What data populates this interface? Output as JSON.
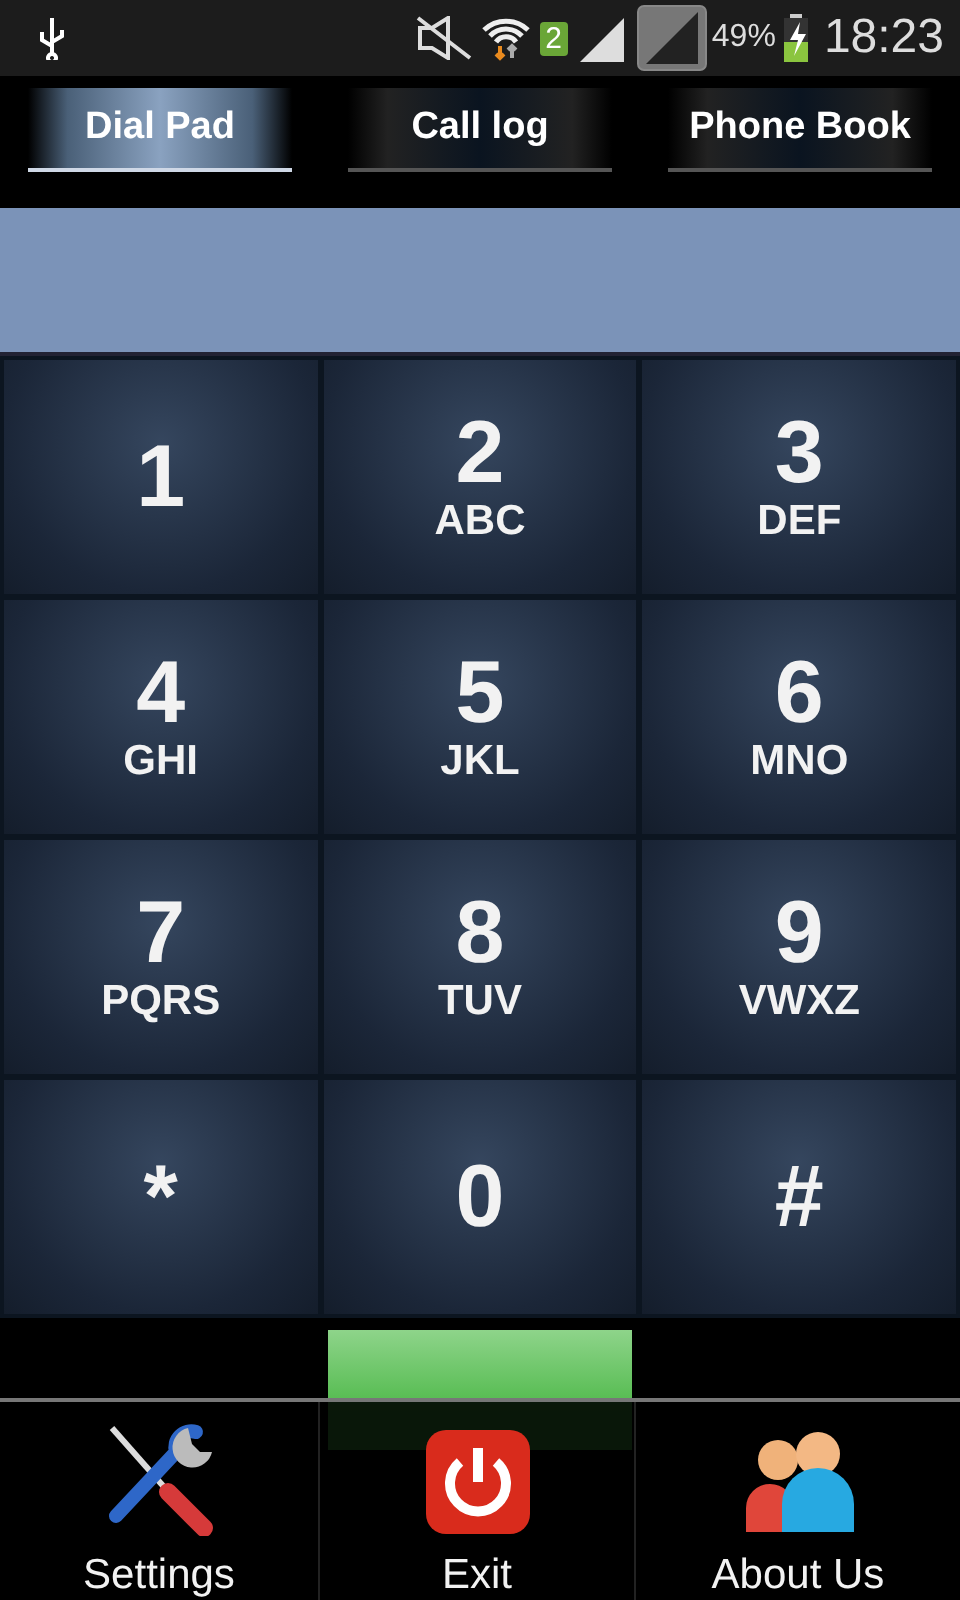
{
  "status_bar": {
    "battery": "49%",
    "time": "18:23",
    "sim_badge": "2"
  },
  "tabs": [
    {
      "label": "Dial Pad",
      "selected": true
    },
    {
      "label": "Call log",
      "selected": false
    },
    {
      "label": "Phone Book",
      "selected": false
    }
  ],
  "keys": [
    {
      "digit": "1"
    },
    {
      "digit": "2",
      "letters": "ABC"
    },
    {
      "digit": "3",
      "letters": "DEF"
    },
    {
      "digit": "4",
      "letters": "GHI"
    },
    {
      "digit": "5",
      "letters": "JKL"
    },
    {
      "digit": "6",
      "letters": "MNO"
    },
    {
      "digit": "7",
      "letters": "PQRS"
    },
    {
      "digit": "8",
      "letters": "TUV"
    },
    {
      "digit": "9",
      "letters": "VWXZ"
    },
    {
      "digit": "*"
    },
    {
      "digit": "0"
    },
    {
      "digit": "#"
    }
  ],
  "menu": [
    {
      "kind": "settings",
      "label": "Settings"
    },
    {
      "kind": "exit",
      "label": "Exit"
    },
    {
      "kind": "about",
      "label": "About Us"
    }
  ]
}
